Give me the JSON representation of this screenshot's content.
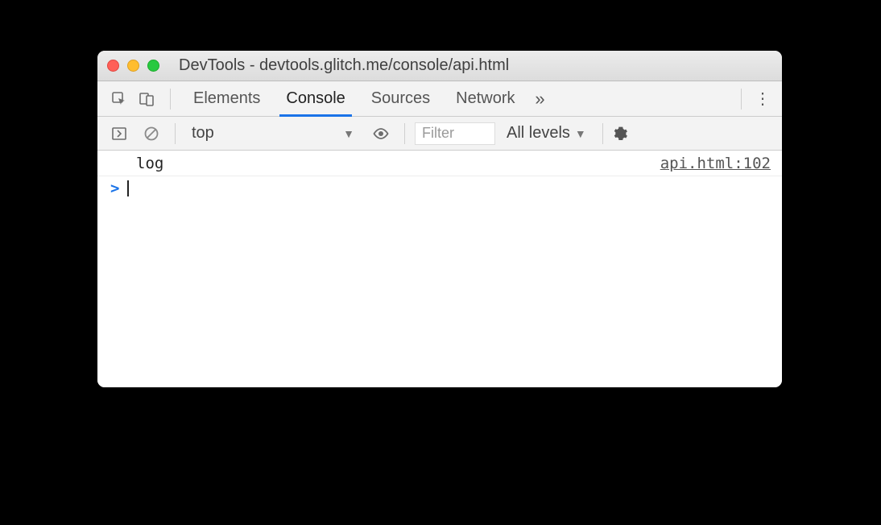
{
  "window": {
    "title": "DevTools - devtools.glitch.me/console/api.html"
  },
  "tabs": {
    "elements": "Elements",
    "console": "Console",
    "sources": "Sources",
    "network": "Network",
    "active": "console"
  },
  "toolbar": {
    "context": "top",
    "filter_placeholder": "Filter",
    "filter_value": "",
    "levels": "All levels"
  },
  "console": {
    "entries": [
      {
        "message": "log",
        "source": "api.html:102"
      }
    ],
    "prompt": ">"
  }
}
